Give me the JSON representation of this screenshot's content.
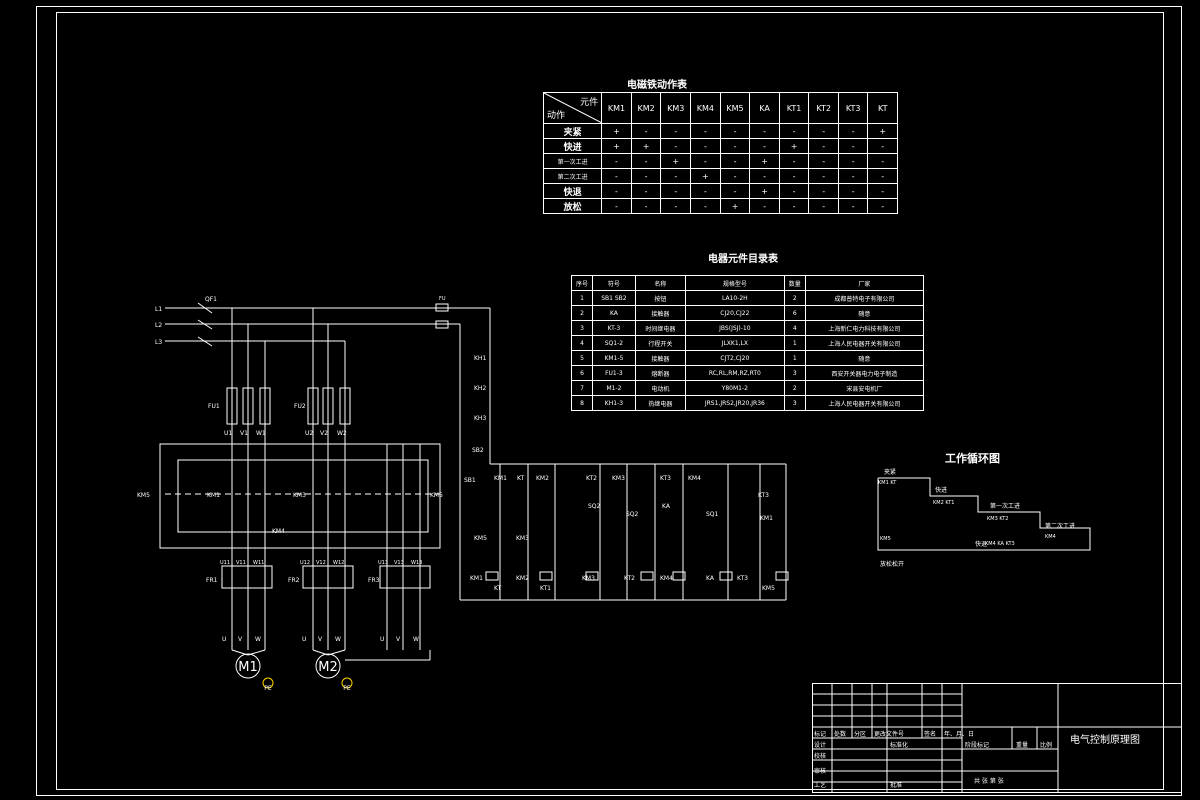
{
  "action_table": {
    "title": "电磁铁动作表",
    "header_top": "元件",
    "header_bottom": "动作",
    "columns": [
      "KM1",
      "KM2",
      "KM3",
      "KM4",
      "KM5",
      "KA",
      "KT1",
      "KT2",
      "KT3",
      "KT"
    ],
    "rows": [
      {
        "label": "夹紧",
        "cells": [
          "+",
          "-",
          "-",
          "-",
          "-",
          "-",
          "-",
          "-",
          "-",
          "+"
        ]
      },
      {
        "label": "快进",
        "cells": [
          "+",
          "+",
          "-",
          "-",
          "-",
          "-",
          "+",
          "-",
          "-",
          "-"
        ]
      },
      {
        "label": "第一次工进",
        "cells": [
          "-",
          "-",
          "+",
          "-",
          "-",
          "+",
          "-",
          "-",
          "-",
          "-"
        ]
      },
      {
        "label": "第二次工进",
        "cells": [
          "-",
          "-",
          "-",
          "+",
          "-",
          "-",
          "-",
          "-",
          "-",
          "-"
        ]
      },
      {
        "label": "快退",
        "cells": [
          "-",
          "-",
          "-",
          "-",
          "-",
          "+",
          "-",
          "-",
          "-",
          "-"
        ]
      },
      {
        "label": "放松",
        "cells": [
          "-",
          "-",
          "-",
          "-",
          "+",
          "-",
          "-",
          "-",
          "-",
          "-"
        ]
      }
    ]
  },
  "component_table": {
    "title": "电器元件目录表",
    "headers": [
      "序号",
      "符号",
      "名称",
      "规格型号",
      "数量",
      "厂家"
    ],
    "rows": [
      [
        "1",
        "SB1 SB2",
        "按钮",
        "LA10-2H",
        "2",
        "成都普特电子有限公司"
      ],
      [
        "2",
        "KA",
        "接触器",
        "CJ20,CJ22",
        "6",
        "随意"
      ],
      [
        "3",
        "KT-3",
        "时间继电器",
        "JBS(JSJ)-10",
        "4",
        "上海新仁电力科技有限公司"
      ],
      [
        "4",
        "SQ1-2",
        "行程开关",
        "JLXK1,LX",
        "1",
        "上海人民电器开关有限公司"
      ],
      [
        "5",
        "KM1-5",
        "接触器",
        "CJT2,CJ20",
        "1",
        "随意"
      ],
      [
        "6",
        "FU1-3",
        "熔断器",
        "RC,RL,RM,RZ,RT0",
        "3",
        "西安开关器电力电子制造"
      ],
      [
        "7",
        "M1-2",
        "电动机",
        "Y80M1-2",
        "2",
        "宋县安电机厂"
      ],
      [
        "8",
        "KH1-3",
        "热继电器",
        "JRS1,JRS2,JR20,JR36",
        "3",
        "上海人民电器开关有限公司"
      ]
    ]
  },
  "cycle_diagram": {
    "title": "工作循环图",
    "steps": [
      "夹紧",
      "快进",
      "第一次工进",
      "第二次工进",
      "快退",
      "放松松开"
    ],
    "tags": [
      "KM1 KT",
      "KM2 KT1",
      "KM3 KT2",
      "KM4",
      "KM4 KA KT3",
      "KM5"
    ]
  },
  "schematic": {
    "lines": [
      "L1",
      "L2",
      "L3"
    ],
    "switch": "QF1",
    "fuses": [
      "FU1",
      "FU2",
      "FU"
    ],
    "motors": [
      "M1",
      "M2"
    ],
    "pe_label": "PE",
    "terminals_top": [
      "U1",
      "V1",
      "W1",
      "U2",
      "V2",
      "W2"
    ],
    "terminals_mid": [
      "U11",
      "V11",
      "W11",
      "U12",
      "V12",
      "W12",
      "U13",
      "V13",
      "W13"
    ],
    "terminals_bot": [
      "U",
      "V",
      "W",
      "U",
      "V",
      "W",
      "U",
      "V",
      "W"
    ],
    "thermal": [
      "FR1",
      "FR2",
      "FR3"
    ],
    "contactors": [
      "KM1",
      "KM2",
      "KM3",
      "KM4",
      "KM5",
      "KA"
    ],
    "control_labels": [
      "KH1",
      "KH2",
      "KH3",
      "SB2",
      "SB1",
      "KM1",
      "KT",
      "KM2",
      "KT2",
      "KM3",
      "KT3",
      "KM4",
      "KT3",
      "KM1",
      "SQ2",
      "SQ2",
      "KA",
      "SQ1",
      "KM5",
      "KM3",
      "KM1",
      "KT",
      "KM2",
      "KT1",
      "KM3",
      "KT2",
      "KM4",
      "KA",
      "KT3",
      "KM5"
    ]
  },
  "title_block": {
    "drawing_title": "电气控制原理图",
    "row_labels": [
      "标记",
      "处数",
      "分区",
      "更改文件号",
      "签名",
      "年、月、日"
    ],
    "design": "设计",
    "standardize": "标准化",
    "check": "校核",
    "review": "审核",
    "process": "工艺",
    "approve": "批准",
    "stage": "阶段标记",
    "weight": "重量",
    "scale": "比例",
    "sheets": "共 张 第 张"
  },
  "colors": {
    "background": "#000000",
    "line": "#ffffff",
    "accent": "#ffd400"
  }
}
